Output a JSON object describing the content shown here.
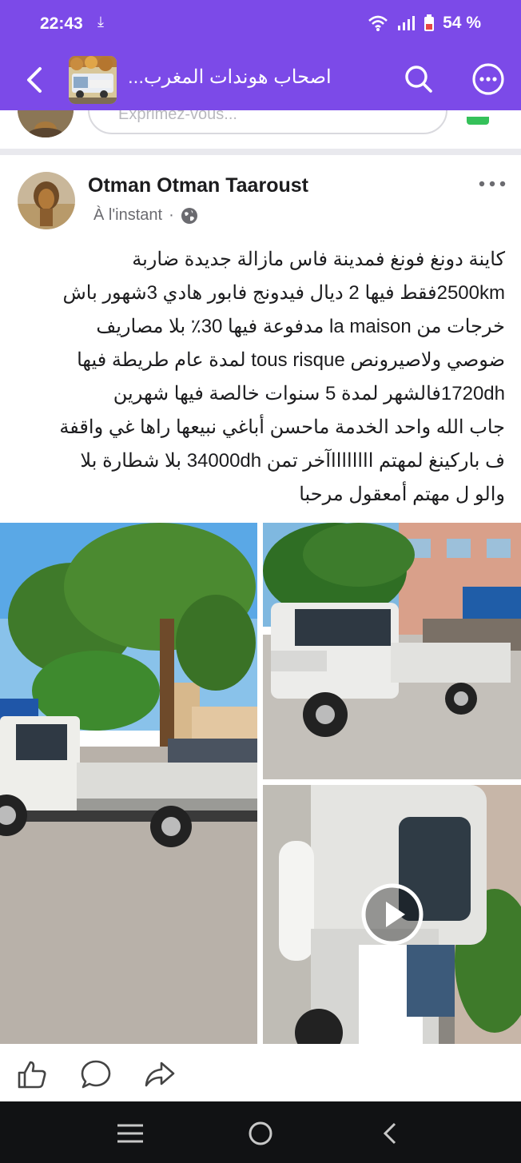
{
  "status": {
    "time": "22:43",
    "download_indicator": "⤓",
    "battery": "54 %"
  },
  "header": {
    "group_name": "اصحاب هوندات المغرب..."
  },
  "composer": {
    "placeholder": "Exprimez-vous..."
  },
  "post": {
    "author": "Otman Otman Taaroust",
    "time": "À l'instant",
    "separator": "·",
    "audience_icon": "globe-icon",
    "lines": [
      "كاينة دونغ فونغ فمدينة فاس مازالة جديدة ضاربة",
      "2500kmفقط فيها 2 ديال فيدونج فابور هادي 3شهور باش",
      "خرجات من la maison مدفوعة فيها 30٪ بلا مصاريف",
      "ضوصي ولاصيرونص tous risque لمدة عام طريطة فيها",
      "1720dhفالشهر لمدة 5 سنوات خالصة فيها شهرين",
      "جاب الله واحد الخدمة ماحسن أباغي نبيعها راها غي واقفة",
      "ف باركينغ لمهتم ااااااااآخر تمن 34000dh بلا شطارة بلا",
      "والو ل مهتم أمعقول مرحبا"
    ]
  },
  "media": [
    {
      "name": "photo-truck-under-tree",
      "type": "image"
    },
    {
      "name": "photo-truck-front",
      "type": "image"
    },
    {
      "name": "video-truck-cab",
      "type": "video"
    }
  ],
  "actions": [
    "like-icon",
    "comment-icon",
    "share-icon"
  ],
  "colors": {
    "appbar": "#7c4ae8",
    "navbar": "#111214",
    "divider": "#e9e9ee"
  }
}
